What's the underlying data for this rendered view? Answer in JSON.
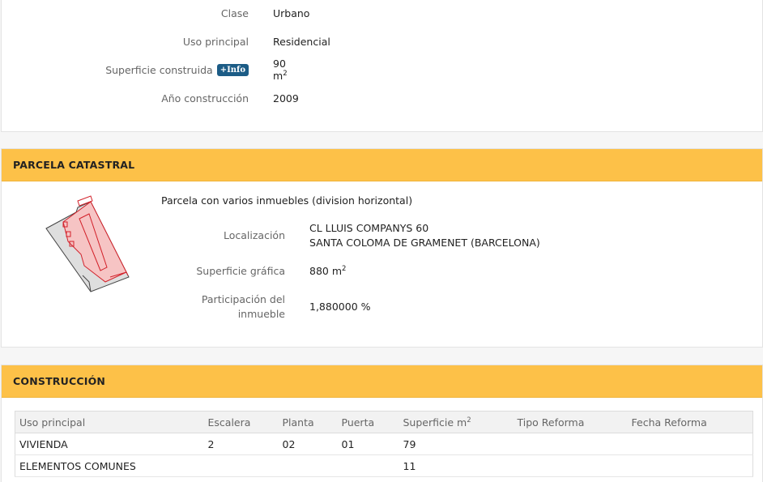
{
  "top_info": {
    "rows": [
      {
        "label": "Clase",
        "value": "Urbano"
      },
      {
        "label": "Uso principal",
        "value": "Residencial"
      },
      {
        "label": "Superficie construida",
        "info_button": "+Info",
        "value": "90 m",
        "value_sup": "2"
      },
      {
        "label": "Año construcción",
        "value": "2009"
      }
    ]
  },
  "parcela": {
    "title": "PARCELA CATASTRAL",
    "description": "Parcela con varios inmuebles (division horizontal)",
    "localizacion_label": "Localización",
    "localizacion_line1": "CL LLUIS COMPANYS 60",
    "localizacion_line2": "SANTA COLOMA DE GRAMENET (BARCELONA)",
    "superficie_label": "Superficie gráfica",
    "superficie_value": "880 m",
    "superficie_sup": "2",
    "participacion_label_1": "Participación del",
    "participacion_label_2": "inmueble",
    "participacion_value": "1,880000 %"
  },
  "construccion": {
    "title": "CONSTRUCCIÓN",
    "headers": [
      "Uso principal",
      "Escalera",
      "Planta",
      "Puerta",
      "Superficie m",
      "Tipo Reforma",
      "Fecha Reforma"
    ],
    "superficie_sup": "2",
    "rows": [
      [
        "VIVIENDA",
        "2",
        "02",
        "01",
        "79",
        "",
        ""
      ],
      [
        "ELEMENTOS COMUNES",
        "",
        "",
        "",
        "11",
        "",
        ""
      ]
    ]
  },
  "colors": {
    "header_bg": "#fdc148",
    "info_badge": "#1c5c86",
    "parcel_fill": "#f6c4c4",
    "parcel_stroke": "#d2212a"
  }
}
